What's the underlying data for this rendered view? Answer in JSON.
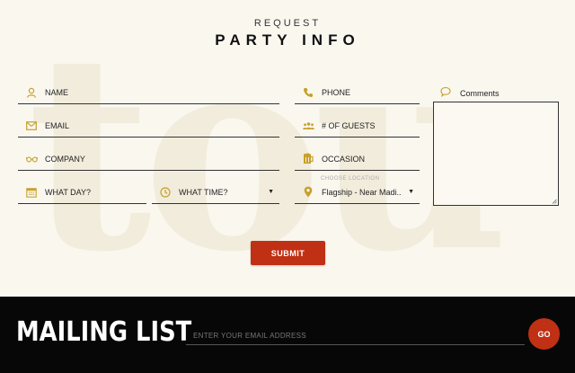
{
  "colors": {
    "accent": "#c7a02b",
    "brand_red": "#c03014",
    "footer_bg": "#070707",
    "page_bg": "#faf7ef"
  },
  "watermark": {
    "text": "tou"
  },
  "header": {
    "kicker": "REQUEST",
    "title": "PARTY INFO"
  },
  "form": {
    "name_label": "NAME",
    "phone_label": "PHONE",
    "email_label": "EMAIL",
    "guests_label": "# OF GUESTS",
    "company_label": "COMPANY",
    "occasion_label": "OCCASION",
    "day_label": "WHAT DAY?",
    "time_label": "WHAT TIME?",
    "location_label": "CHOOSE LOCATION",
    "location_value": "Flagship - Near Madi..",
    "comments_label": "Comments",
    "submit_label": "SUBMIT"
  },
  "icons": {
    "name": "person-icon",
    "phone": "phone-icon",
    "email": "envelope-icon",
    "guests": "group-icon",
    "company": "glasses-icon",
    "occasion": "beer-mug-icon",
    "day": "calendar-icon",
    "time": "clock-icon",
    "location": "map-pin-icon",
    "comments": "speech-bubble-icon"
  },
  "footer": {
    "title": "MAILING LIST",
    "email_placeholder": "ENTER YOUR EMAIL ADDRESS",
    "go_label": "GO"
  }
}
